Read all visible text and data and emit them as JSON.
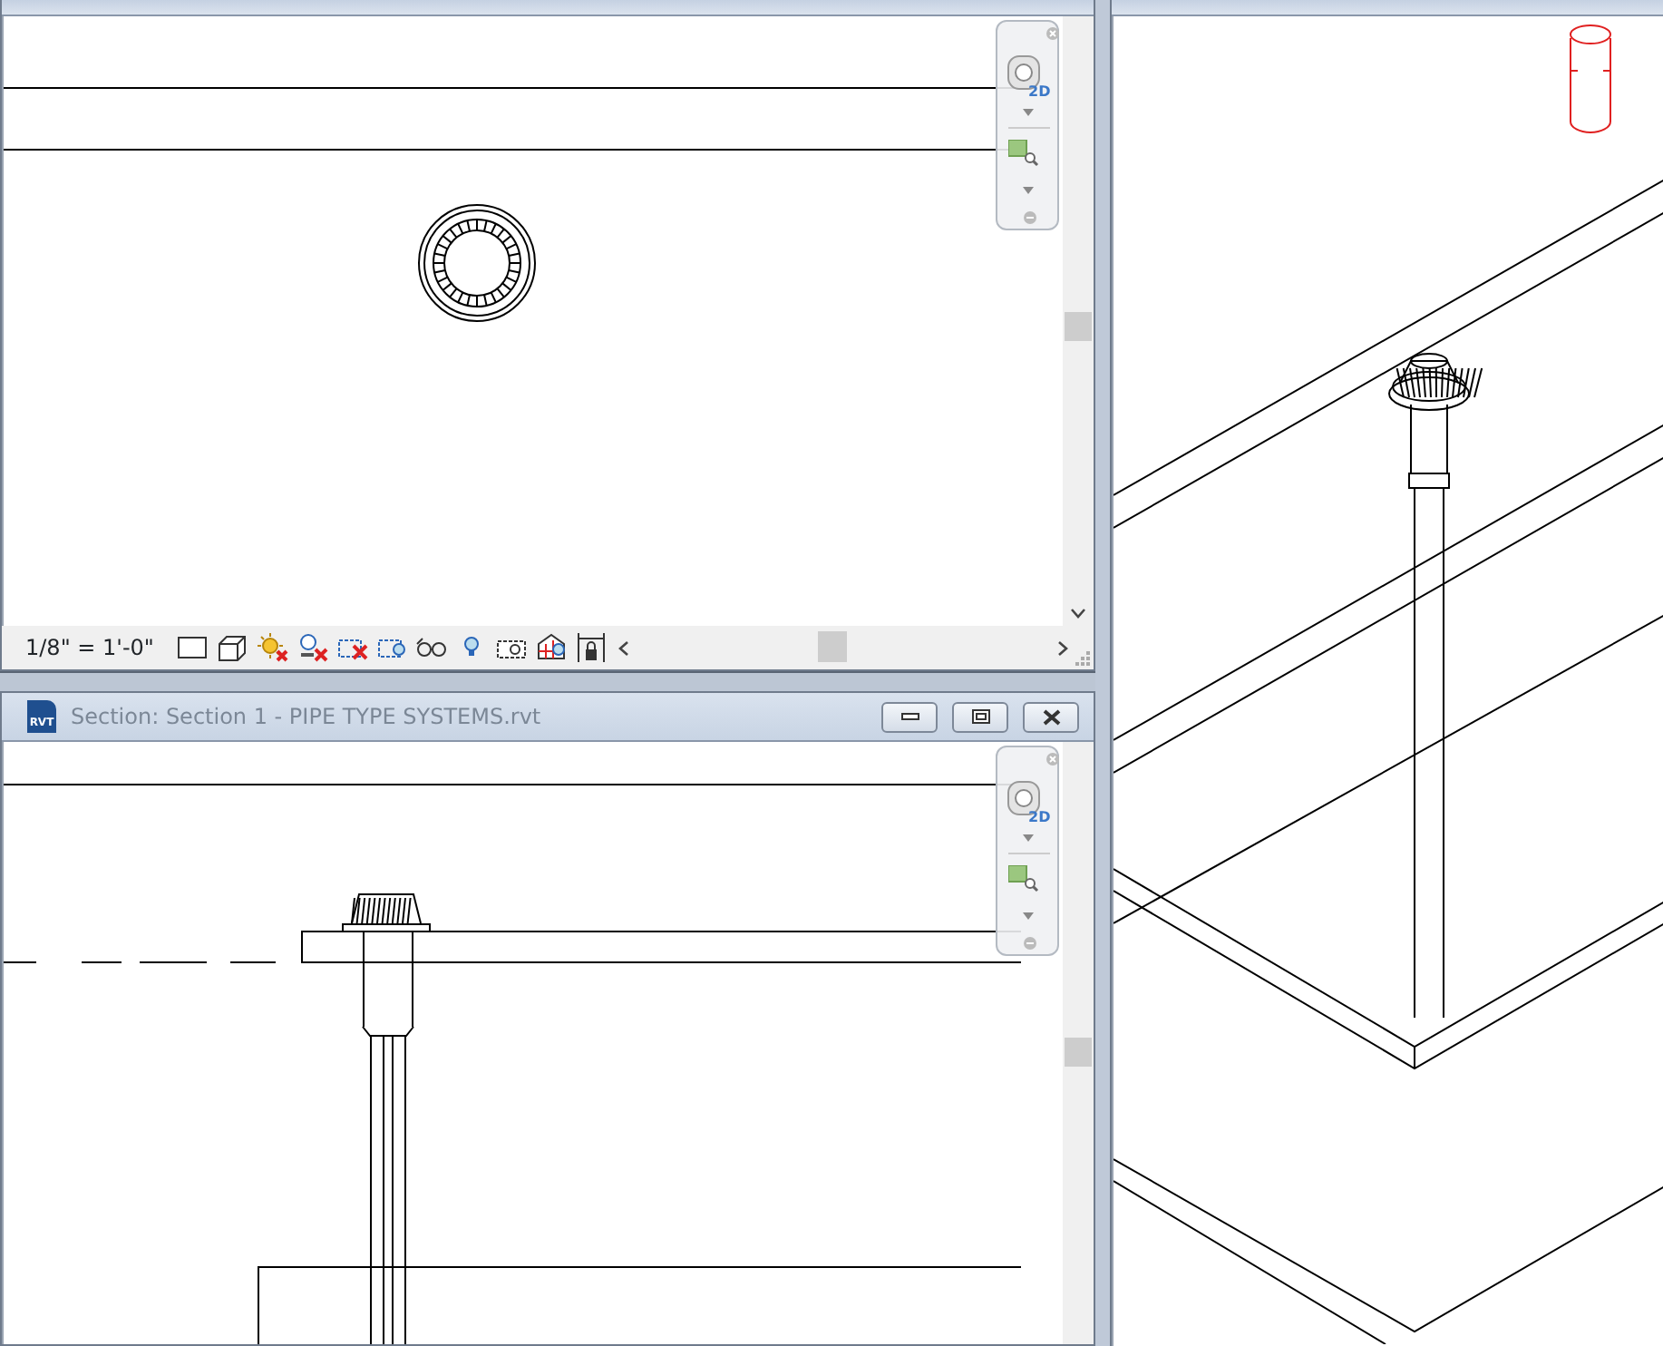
{
  "plan_view": {
    "navigation_label": "2D",
    "view_scale": "1/8\" = 1'-0\""
  },
  "section_view": {
    "file_icon_label": "RVT",
    "title": "Section: Section 1 - PIPE TYPE SYSTEMS.rvt",
    "navigation_label": "2D"
  }
}
